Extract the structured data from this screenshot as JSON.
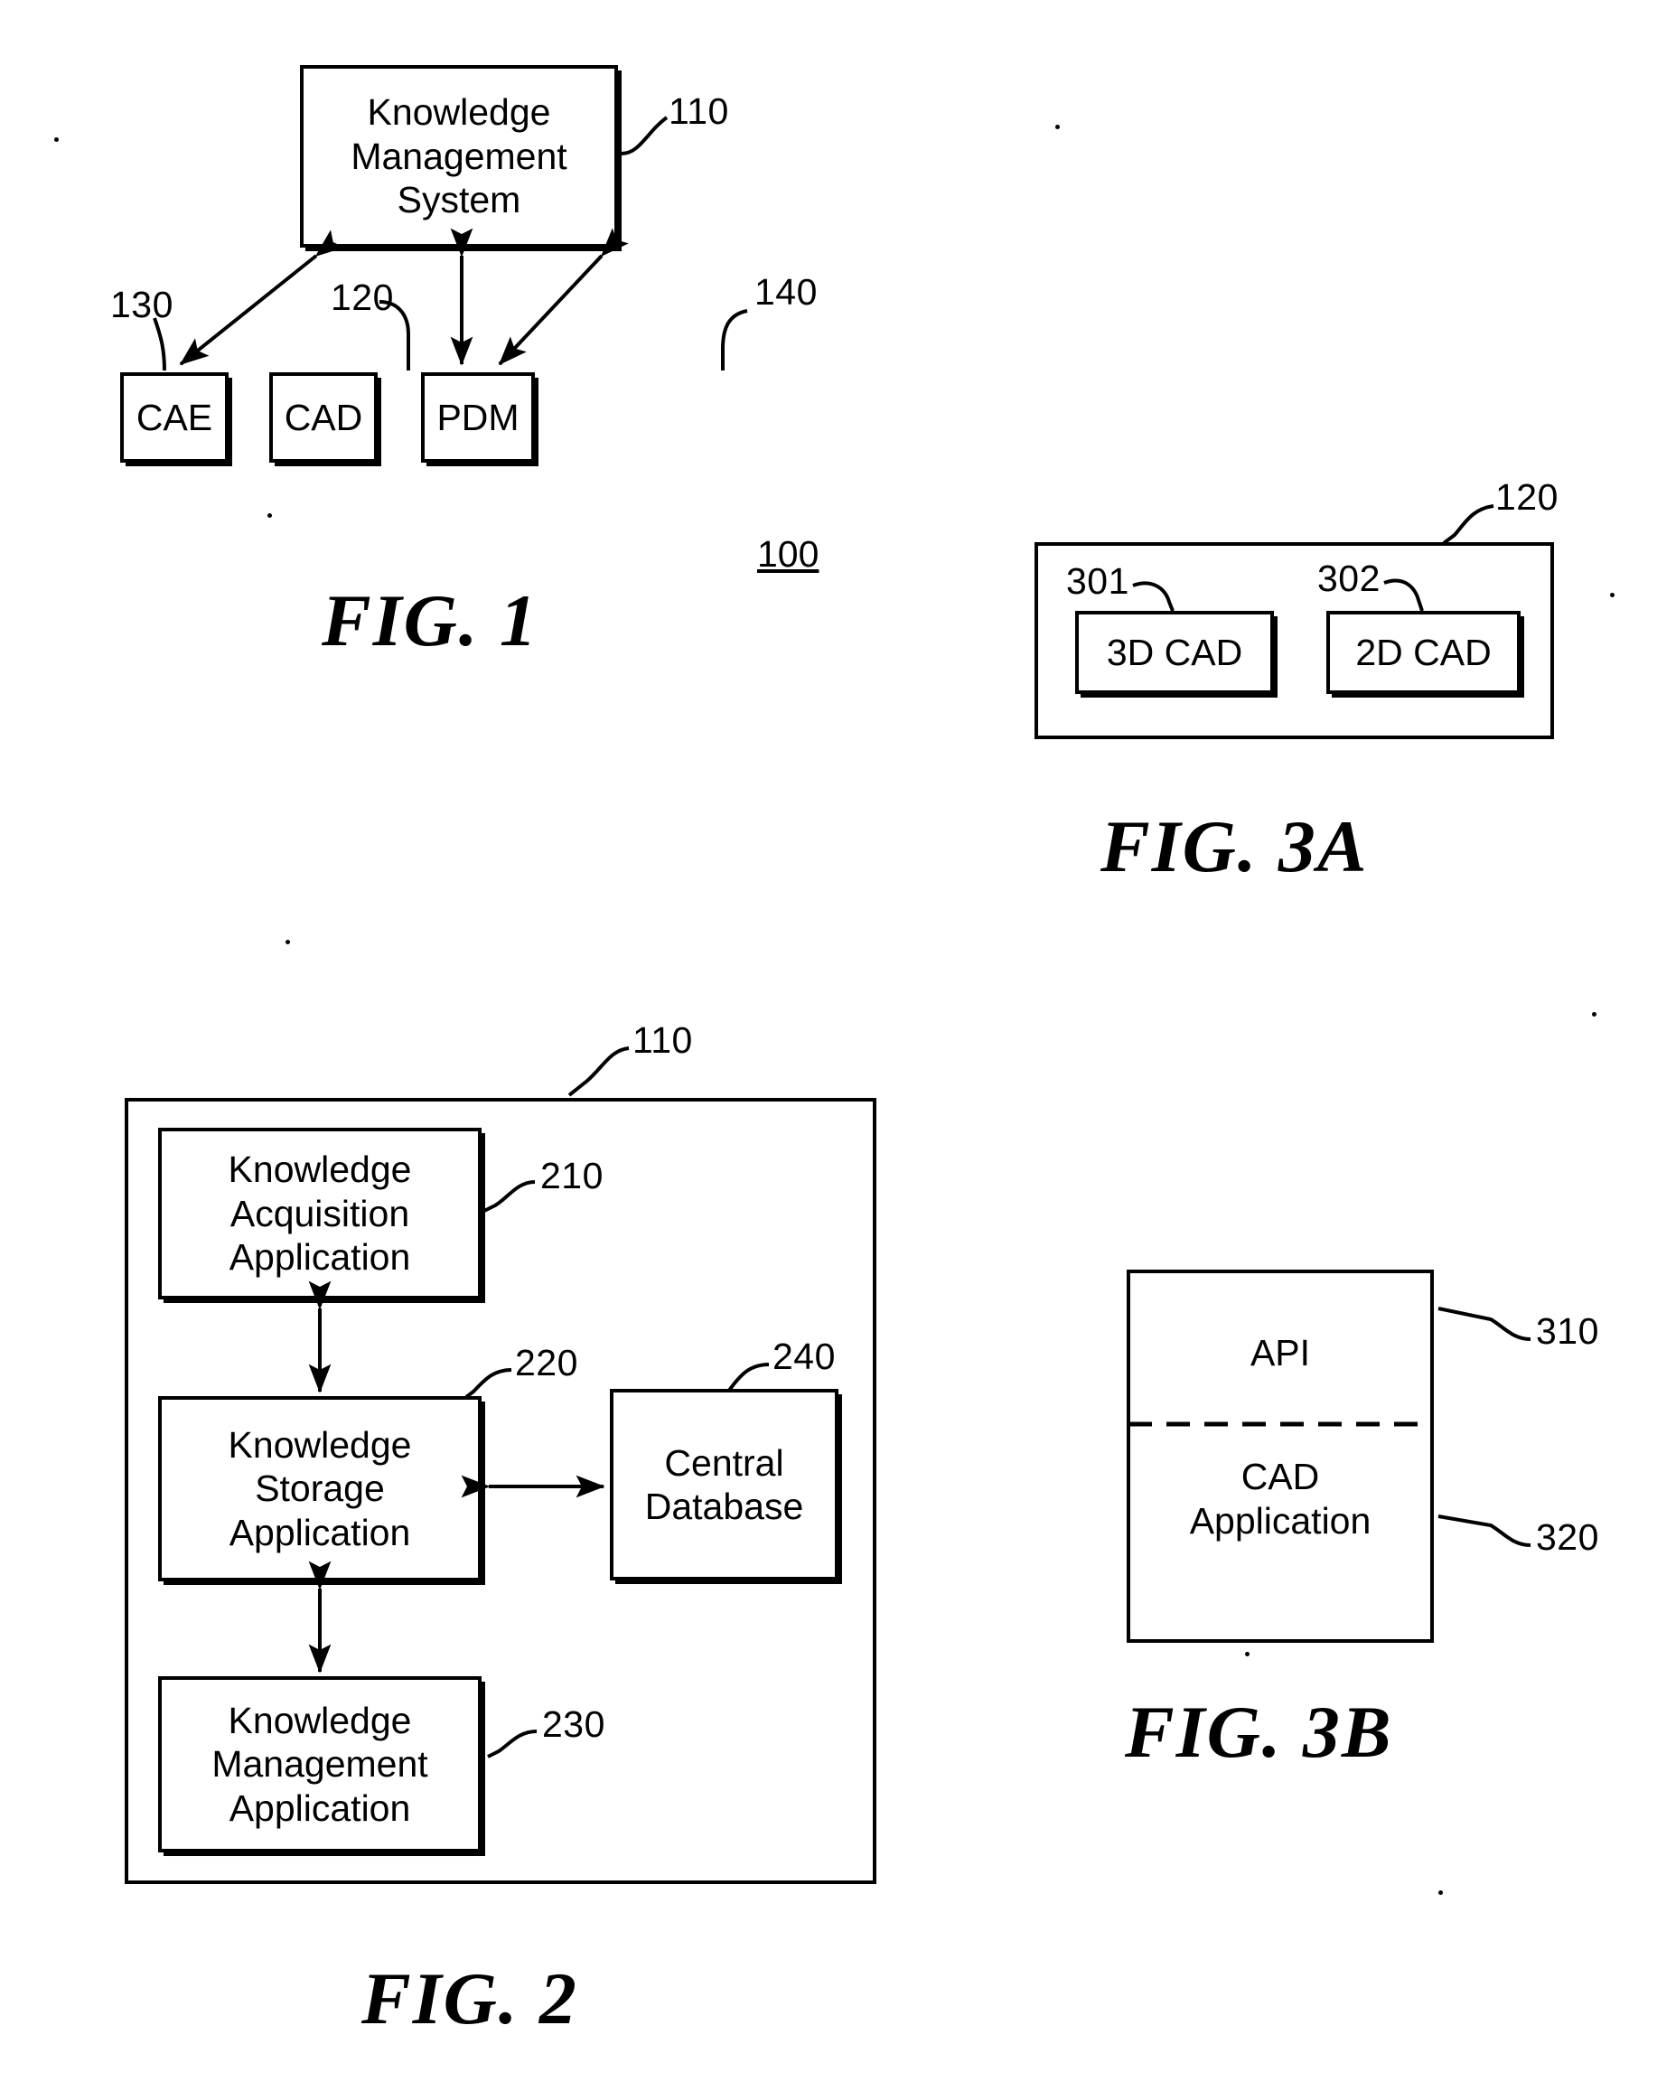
{
  "figures": [
    {
      "id": "fig1",
      "caption": "FIG. 1",
      "system_ref": "100",
      "nodes": [
        {
          "id": "kms",
          "label": "Knowledge\nManagement\nSystem",
          "ref": "110"
        },
        {
          "id": "cae",
          "label": "CAE",
          "ref": "130"
        },
        {
          "id": "cad",
          "label": "CAD",
          "ref": "120"
        },
        {
          "id": "pdm",
          "label": "PDM",
          "ref": "140"
        }
      ],
      "connections": [
        {
          "from": "kms",
          "to": "cae",
          "style": "double-arrow"
        },
        {
          "from": "kms",
          "to": "cad",
          "style": "double-arrow"
        },
        {
          "from": "kms",
          "to": "pdm",
          "style": "double-arrow"
        }
      ]
    },
    {
      "id": "fig2",
      "caption": "FIG. 2",
      "container_ref": "110",
      "nodes": [
        {
          "id": "ka",
          "label": "Knowledge\nAcquisition\nApplication",
          "ref": "210"
        },
        {
          "id": "ks",
          "label": "Knowledge\nStorage\nApplication",
          "ref": "220"
        },
        {
          "id": "km",
          "label": "Knowledge\nManagement\nApplication",
          "ref": "230"
        },
        {
          "id": "cdb",
          "label": "Central\nDatabase",
          "ref": "240"
        }
      ],
      "connections": [
        {
          "from": "ka",
          "to": "ks",
          "style": "double-arrow"
        },
        {
          "from": "ks",
          "to": "km",
          "style": "double-arrow"
        },
        {
          "from": "ks",
          "to": "cdb",
          "style": "double-arrow"
        }
      ]
    },
    {
      "id": "fig3a",
      "caption": "FIG. 3A",
      "container_ref": "120",
      "nodes": [
        {
          "id": "cad3d",
          "label": "3D CAD",
          "ref": "301"
        },
        {
          "id": "cad2d",
          "label": "2D CAD",
          "ref": "302"
        }
      ]
    },
    {
      "id": "fig3b",
      "caption": "FIG. 3B",
      "nodes": [
        {
          "id": "api",
          "label": "API",
          "ref": "310"
        },
        {
          "id": "cadapp",
          "label": "CAD\nApplication",
          "ref": "320"
        }
      ],
      "divider": "dashed"
    }
  ],
  "fig1": {
    "kms_label": "Knowledge\nManagement\nSystem",
    "kms_ref": "110",
    "cae_label": "CAE",
    "cae_ref": "130",
    "cad_label": "CAD",
    "cad_ref": "120",
    "pdm_label": "PDM",
    "pdm_ref": "140",
    "system_ref": "100",
    "caption": "FIG. 1"
  },
  "fig2": {
    "outer_ref": "110",
    "ka_label": "Knowledge\nAcquisition\nApplication",
    "ka_ref": "210",
    "ks_label": "Knowledge\nStorage\nApplication",
    "ks_ref": "220",
    "km_label": "Knowledge\nManagement\nApplication",
    "km_ref": "230",
    "cdb_label": "Central\nDatabase",
    "cdb_ref": "240",
    "caption": "FIG. 2"
  },
  "fig3a": {
    "outer_ref": "120",
    "cad3d_label": "3D CAD",
    "cad3d_ref": "301",
    "cad2d_label": "2D CAD",
    "cad2d_ref": "302",
    "caption": "FIG. 3A"
  },
  "fig3b": {
    "api_label": "API",
    "api_ref": "310",
    "cadapp_label": "CAD\nApplication",
    "cadapp_ref": "320",
    "caption": "FIG. 3B"
  },
  "colors": {
    "ink": "#000000",
    "paper": "#ffffff"
  }
}
